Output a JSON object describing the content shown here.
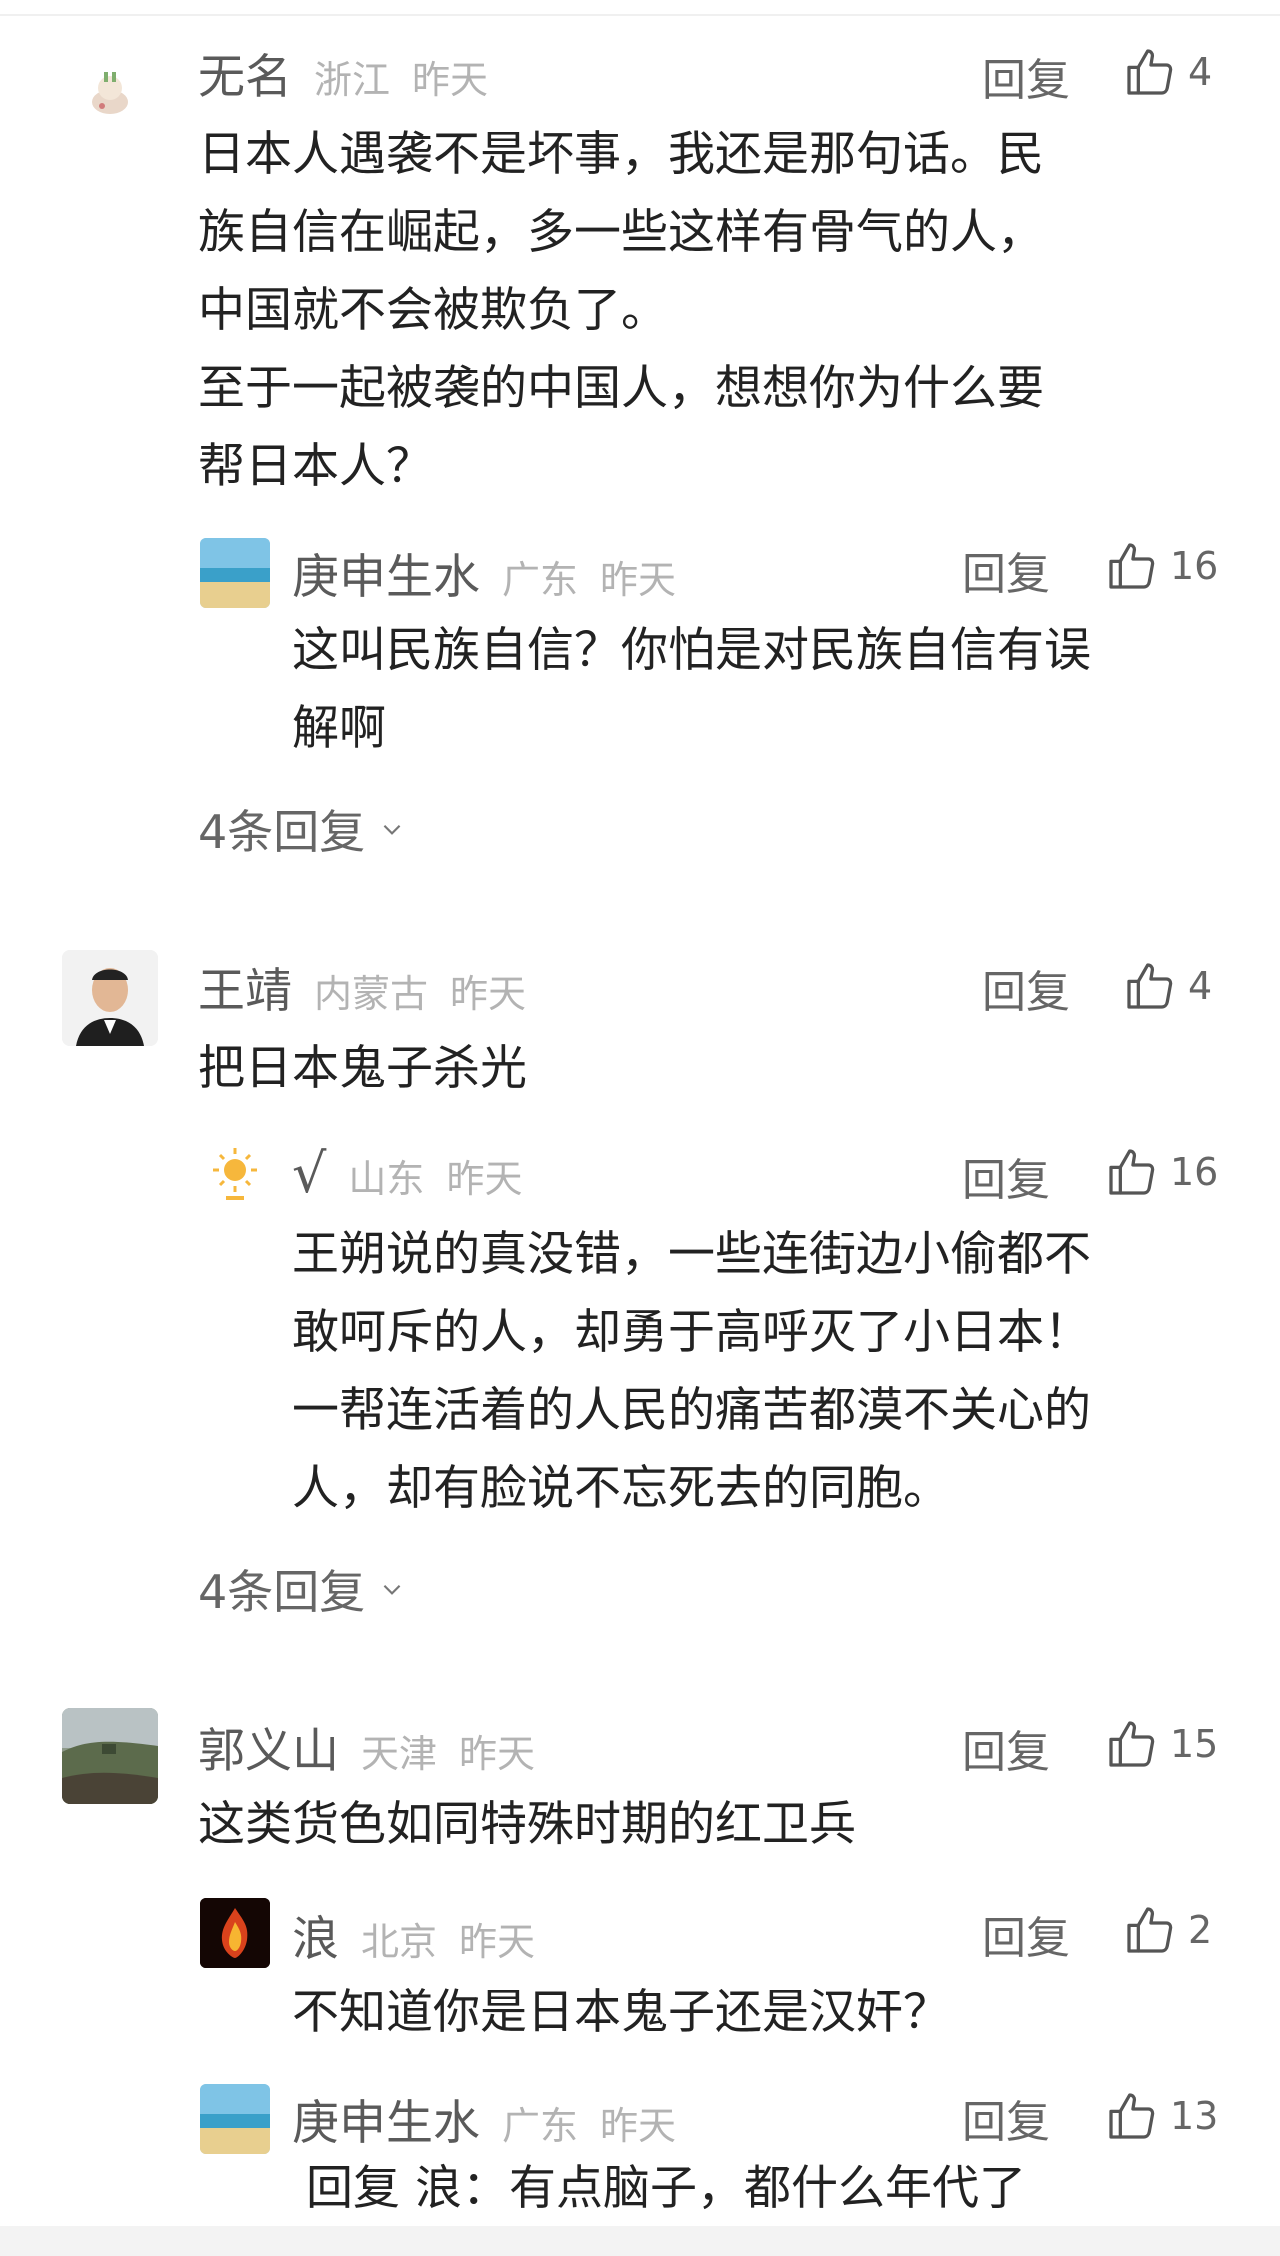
{
  "ui": {
    "reply_label": "回复",
    "more_chevron_icon": "chevron-down-icon",
    "like_icon": "thumb-up-icon",
    "colors": {
      "name": "#5a5a5a",
      "meta": "#b3b3b3",
      "text": "#222222",
      "action": "#666666"
    }
  },
  "comments": [
    {
      "user": "无名",
      "location": "浙江",
      "time": "昨天",
      "likes": "4",
      "lines": [
        "日本人遇袭不是坏事，我还是那句话。民",
        "族自信在崛起，多一些这样有骨气的人，",
        "中国就不会被欺负了。",
        "至于一起被袭的中国人，想想你为什么要",
        "帮日本人？"
      ],
      "replies": [
        {
          "user": "庚申生水",
          "location": "广东",
          "time": "昨天",
          "likes": "16",
          "lines": [
            "这叫民族自信？你怕是对民族自信有误",
            "解啊"
          ]
        }
      ],
      "more_replies": "4条回复"
    },
    {
      "user": "王靖",
      "location": "内蒙古",
      "time": "昨天",
      "likes": "4",
      "lines": [
        "把日本鬼子杀光"
      ],
      "replies": [
        {
          "user": "√",
          "location": "山东",
          "time": "昨天",
          "likes": "16",
          "lines": [
            "王朔说的真没错，一些连街边小偷都不",
            "敢呵斥的人，却勇于高呼灭了小日本！",
            "一帮连活着的人民的痛苦都漠不关心的",
            "人，却有脸说不忘死去的同胞。"
          ]
        }
      ],
      "more_replies": "4条回复"
    },
    {
      "user": "郭义山",
      "location": "天津",
      "time": "昨天",
      "likes": "15",
      "lines": [
        "这类货色如同特殊时期的红卫兵"
      ],
      "replies": [
        {
          "user": "浪",
          "location": "北京",
          "time": "昨天",
          "likes": "2",
          "lines": [
            "不知道你是日本鬼子还是汉奸？"
          ]
        },
        {
          "user": "庚申生水",
          "location": "广东",
          "time": "昨天",
          "likes": "13",
          "lines": [
            "回复 浪：有点脑子，都什么年代了"
          ]
        }
      ]
    }
  ]
}
